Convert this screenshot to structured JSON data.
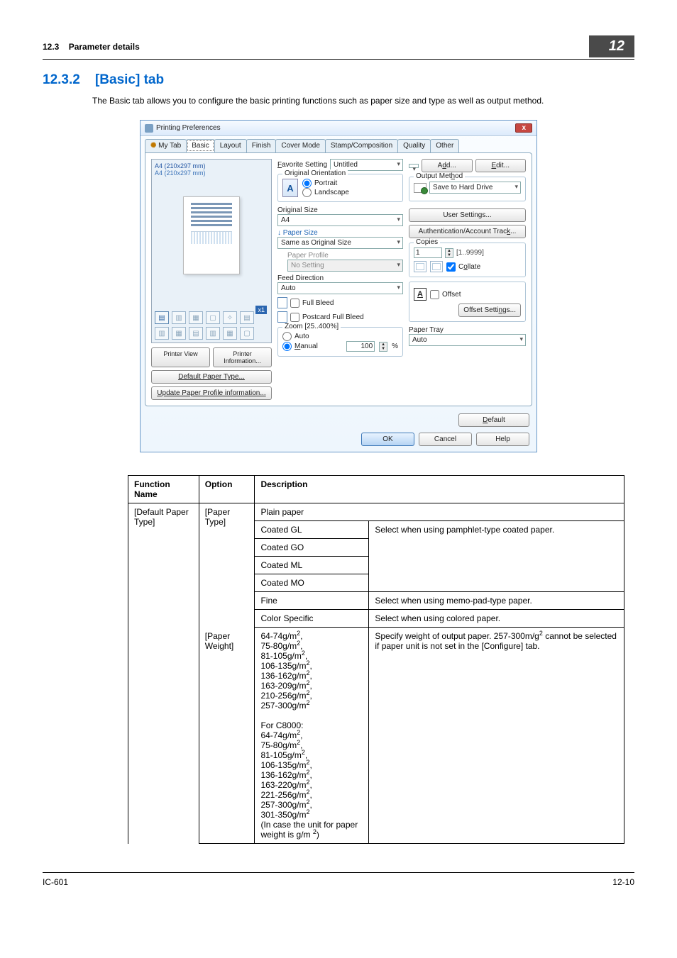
{
  "header": {
    "section": "12.3",
    "section_title": "Parameter details",
    "chapter": "12"
  },
  "title": {
    "num": "12.3.2",
    "text": "[Basic] tab"
  },
  "intro": "The Basic tab allows you to configure the basic printing functions such as paper size and type as well as output method.",
  "dialog": {
    "window_title": "Printing Preferences",
    "close": "x",
    "tabs": [
      "My Tab",
      "Basic",
      "Layout",
      "Finish",
      "Cover Mode",
      "Stamp/Composition",
      "Quality",
      "Other"
    ],
    "active_tab": "Basic",
    "preview": {
      "line1": "A4 (210x297 mm)",
      "line2": "A4 (210x297 mm)",
      "tag": "x1",
      "btn_printer_view": "Printer View",
      "btn_printer_info": "Printer Information...",
      "btn_default_type": "Default Paper Type...",
      "btn_update_profile": "Update Paper Profile information..."
    },
    "favorite": {
      "label": "Favorite Setting",
      "value": "Untitled",
      "add": "Add...",
      "edit": "Edit..."
    },
    "orientation": {
      "legend": "Original Orientation",
      "portrait": "Portrait",
      "landscape": "Landscape"
    },
    "original_size": {
      "label": "Original Size",
      "value": "A4"
    },
    "paper_size": {
      "label": "Paper Size",
      "value": "Same as Original Size",
      "profile_label": "Paper Profile",
      "profile_value": "No Setting"
    },
    "feed": {
      "label": "Feed Direction",
      "value": "Auto"
    },
    "full_bleed": "Full Bleed",
    "postcard": "Postcard Full Bleed",
    "zoom": {
      "legend": "Zoom [25..400%]",
      "auto": "Auto",
      "manual": "Manual",
      "value": "100",
      "unit": "%"
    },
    "output_method": {
      "label": "Output Method",
      "value": "Save to Hard Drive"
    },
    "user_settings": "User Settings...",
    "auth": "Authentication/Account Track...",
    "copies": {
      "legend": "Copies",
      "value": "1",
      "range": "[1..9999]",
      "collate": "Collate"
    },
    "offset": {
      "label": "Offset",
      "settings": "Offset Settings..."
    },
    "paper_tray": {
      "label": "Paper Tray",
      "value": "Auto"
    },
    "default": "Default",
    "ok": "OK",
    "cancel": "Cancel",
    "help": "Help"
  },
  "table": {
    "headers": [
      "Function Name",
      "Option",
      "Description"
    ],
    "fn_default_paper_type": "[Default Paper Type]",
    "opt_paper_type": "[Paper Type]",
    "opt_paper_weight": "[Paper Weight]",
    "plain": "Plain paper",
    "coated_gl": "Coated GL",
    "coated_go": "Coated GO",
    "coated_ml": "Coated ML",
    "coated_mo": "Coated MO",
    "fine": "Fine",
    "color_specific": "Color Specific",
    "coated_note": "Select when using  pamphlet-type coated paper.",
    "fine_note": "Select when using memo-pad-type paper.",
    "color_note": "Select when using colored paper.",
    "weight_list1": [
      "64-74g/m",
      "75-80g/m",
      "81-105g/m",
      "106-135g/m",
      "136-162g/m",
      "163-209g/m",
      "210-256g/m",
      "257-300g/m"
    ],
    "weight_c8000_label": "For C8000:",
    "weight_list2": [
      "64-74g/m",
      "75-80g/m",
      "81-105g/m",
      "106-135g/m",
      "136-162g/m",
      "163-220g/m",
      "221-256g/m",
      "257-300g/m",
      "301-350g/m"
    ],
    "weight_footnote_a": "(In case the unit for paper weight is g/m ",
    "weight_footnote_b": ")",
    "weight_desc_a": "Specify weight of output paper. 257-300m/g",
    "weight_desc_b": " cannot be selected if paper unit is not set in the [Configure] tab."
  },
  "footer": {
    "left": "IC-601",
    "right": "12-10"
  }
}
